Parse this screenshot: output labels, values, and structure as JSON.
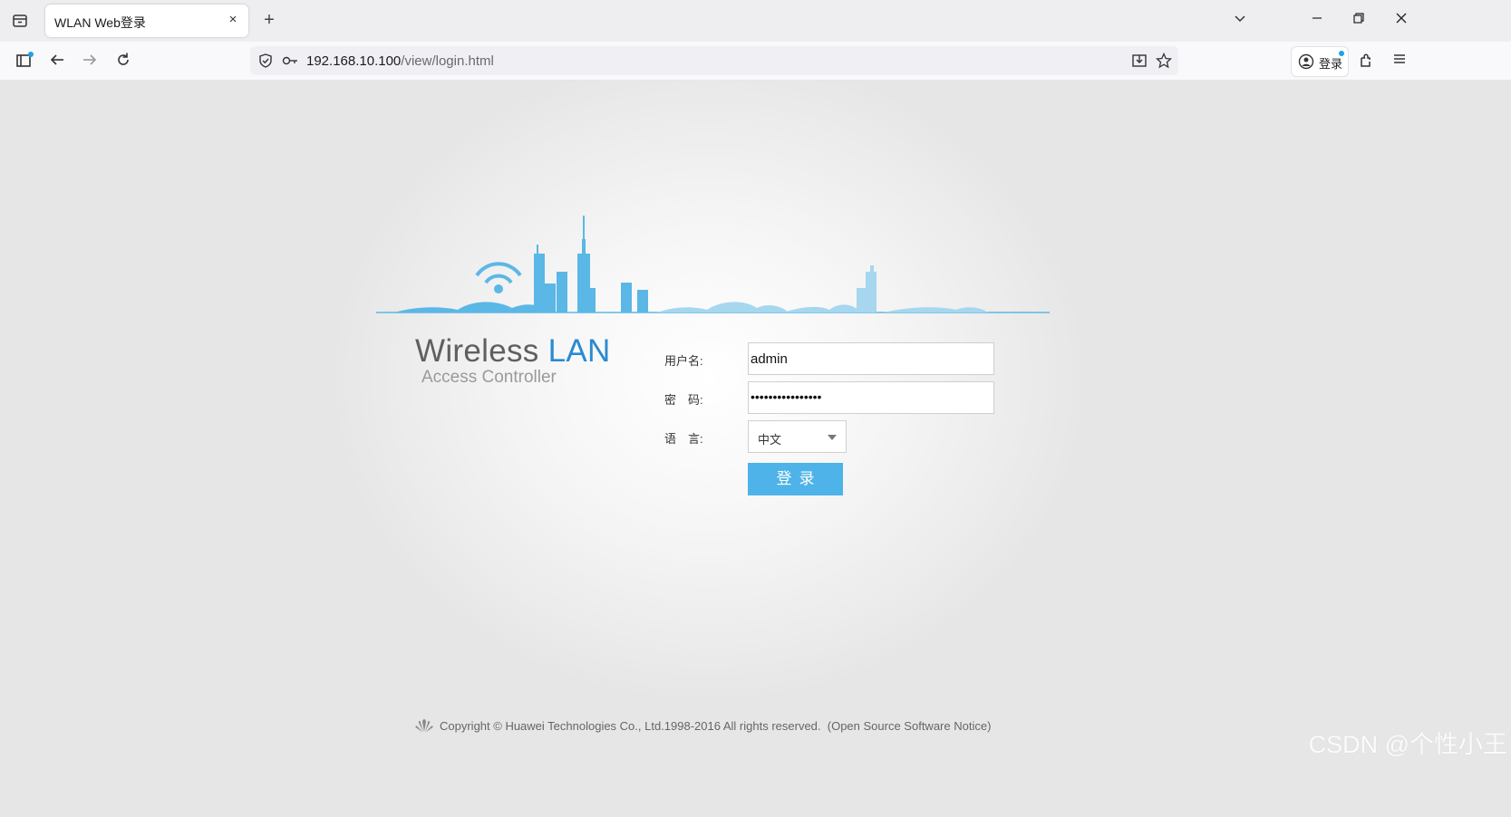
{
  "browser": {
    "tab_title": "WLAN Web登录",
    "tab_close": "×",
    "new_tab": "+",
    "url_host": "192.168.10.100",
    "url_path": "/view/login.html",
    "account_label": "登录"
  },
  "brand": {
    "title_prefix": "Wireless ",
    "title_highlight": "LAN",
    "subtitle": "Access Controller"
  },
  "form": {
    "username_label": "用户名:",
    "username_value": "admin",
    "password_label": "密　码:",
    "password_value": "••••••••••••••••",
    "language_label": "语　言:",
    "language_value": "中文",
    "login_button": "登录"
  },
  "footer": {
    "copyright": "Copyright © Huawei Technologies Co., Ltd.1998-2016 All rights reserved.",
    "notice": "(Open Source Software Notice)"
  },
  "watermark": "CSDN @个性小王",
  "colors": {
    "accent": "#4eb3e8",
    "skyline": "#5bb7e6",
    "skyline_light": "#a7d6ef",
    "brand_lan": "#2a8ad2"
  }
}
